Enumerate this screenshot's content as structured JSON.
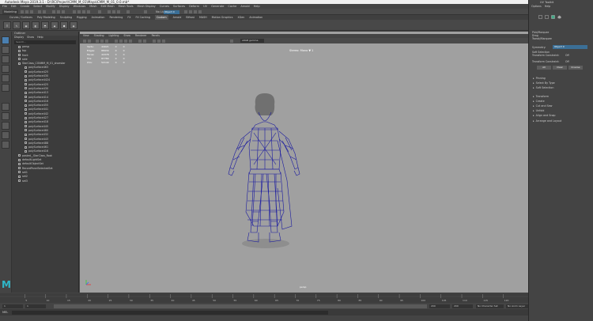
{
  "window": {
    "title": "Autodesk Maya 2019.3.1 - D:\\RC\\Project\\CMM_M_01\\Maya\\CMM_M_01_0.0.mb*",
    "controls": [
      "—",
      "☐",
      "✕"
    ]
  },
  "menubar": [
    "File",
    "Edit",
    "Create",
    "Select",
    "Modify",
    "Display",
    "Windows",
    "Mesh",
    "Edit Mesh",
    "Mesh Tools",
    "Mesh Display",
    "Curves",
    "Surfaces",
    "Deform",
    "UV",
    "Generate",
    "Cache",
    "Arnold",
    "Help"
  ],
  "statusline": {
    "mode": "Modeling",
    "live_surface": "No Live Surface",
    "symmetry": "Object X"
  },
  "shelf_tabs": [
    "Curves / Surfaces",
    "Poly Modeling",
    "Sculpting",
    "Rigging",
    "Animation",
    "Rendering",
    "FX",
    "FX Caching",
    "Custom",
    "Arnold",
    "Bifrost",
    "MASH",
    "Motion Graphics",
    "XGen",
    "Animation"
  ],
  "shelf_active_tab": "Custom",
  "outliner": {
    "title": "Outliner",
    "menu": [
      "Display",
      "Show",
      "Help"
    ],
    "search_placeholder": "Search...",
    "items": [
      {
        "label": "persp",
        "indent": false
      },
      {
        "label": "top",
        "indent": false
      },
      {
        "label": "front",
        "indent": false
      },
      {
        "label": "side",
        "indent": false
      },
      {
        "label": "StarClass_CONMM_M_01_shoestar",
        "indent": false
      },
      {
        "label": "polySurface463",
        "indent": true
      },
      {
        "label": "polySurface425",
        "indent": true
      },
      {
        "label": "polySurface430",
        "indent": true
      },
      {
        "label": "polySurface4424",
        "indent": true
      },
      {
        "label": "polySurface425",
        "indent": true
      },
      {
        "label": "polySurface430",
        "indent": true
      },
      {
        "label": "polySurface413",
        "indent": true
      },
      {
        "label": "polySurface414",
        "indent": true
      },
      {
        "label": "polySurface416",
        "indent": true
      },
      {
        "label": "polySurface455",
        "indent": true
      },
      {
        "label": "polySurface441",
        "indent": true
      },
      {
        "label": "polySurface442",
        "indent": true
      },
      {
        "label": "polySurface427",
        "indent": true
      },
      {
        "label": "polySurface418",
        "indent": true
      },
      {
        "label": "polySurface445",
        "indent": true
      },
      {
        "label": "polySurface460",
        "indent": true
      },
      {
        "label": "polySurface432",
        "indent": true
      },
      {
        "label": "polySurface443",
        "indent": true
      },
      {
        "label": "polySurface488",
        "indent": true
      },
      {
        "label": "polySurface461",
        "indent": true
      },
      {
        "label": "polySurface416",
        "indent": true
      },
      {
        "label": "pasted__StarClass_Root",
        "indent": false
      },
      {
        "label": "defaultLightSet",
        "indent": false
      },
      {
        "label": "defaultObjectSet",
        "indent": false
      },
      {
        "label": "RecordPanelSelectedSet",
        "indent": false
      },
      {
        "label": "set1",
        "indent": false
      },
      {
        "label": "set2",
        "indent": false
      },
      {
        "label": "set3",
        "indent": false
      }
    ]
  },
  "viewport": {
    "menu": [
      "View",
      "Shading",
      "Lighting",
      "Show",
      "Renderer",
      "Panels"
    ],
    "gamma_label": "sRGB gamma",
    "hud": [
      {
        "label": "Verts:",
        "v1": "44021",
        "v2": "0",
        "v3": "0"
      },
      {
        "label": "Edges:",
        "v1": "88934",
        "v2": "0",
        "v3": "0"
      },
      {
        "label": "Faces:",
        "v1": "44378",
        "v2": "0",
        "v3": "0"
      },
      {
        "label": "Tris:",
        "v1": "87780",
        "v2": "0",
        "v3": "0"
      },
      {
        "label": "UVs:",
        "v1": "52140",
        "v2": "0",
        "v3": "0"
      }
    ],
    "camera_label": "Stereo: Mono ▼ 1",
    "persp_label": "persp",
    "wire_color": "#1a1aa0",
    "background": "#a0a0a0"
  },
  "timeline": {
    "ticks": [
      "5",
      "10",
      "15",
      "20",
      "25",
      "30",
      "35",
      "40",
      "45",
      "50",
      "55",
      "60",
      "65",
      "70",
      "75",
      "80",
      "85",
      "90",
      "95",
      "100",
      "105",
      "110",
      "115",
      "120"
    ],
    "current_frame": "1",
    "range_start": "1",
    "range_start_2": "1",
    "range_end": "120",
    "range_end_2": "200",
    "anim_end": "200",
    "char_set": "No Character Set",
    "anim_layer": "No Anim Layer",
    "fps": "24 fps"
  },
  "cmdline": {
    "lang": "MEL"
  },
  "ui_toolkit": {
    "title": "UV Toolkit",
    "menu": [
      "Options",
      "Help"
    ],
    "pick_marquee": "Pick/Marquee",
    "drag": "Drag",
    "tweak_marquee": "Tweak/Marquee",
    "symmetry_label": "Symmetry:",
    "symmetry_value": "Object X",
    "soft_selection": "Soft Selection",
    "transform_constraint_label": "Transform Constraint:",
    "transform_constraint_value": "Off",
    "transform_constraint2_label": "Transform Constraint:",
    "transform_constraint2_value": "Off",
    "buttons": [
      "All",
      "Clear",
      "Inverse"
    ],
    "sections": [
      "Pinning",
      "Select By Type",
      "Soft Selection",
      "Transform",
      "Create",
      "Cut and Sew",
      "Unfold",
      "Align and Snap",
      "Arrange and Layout"
    ]
  }
}
